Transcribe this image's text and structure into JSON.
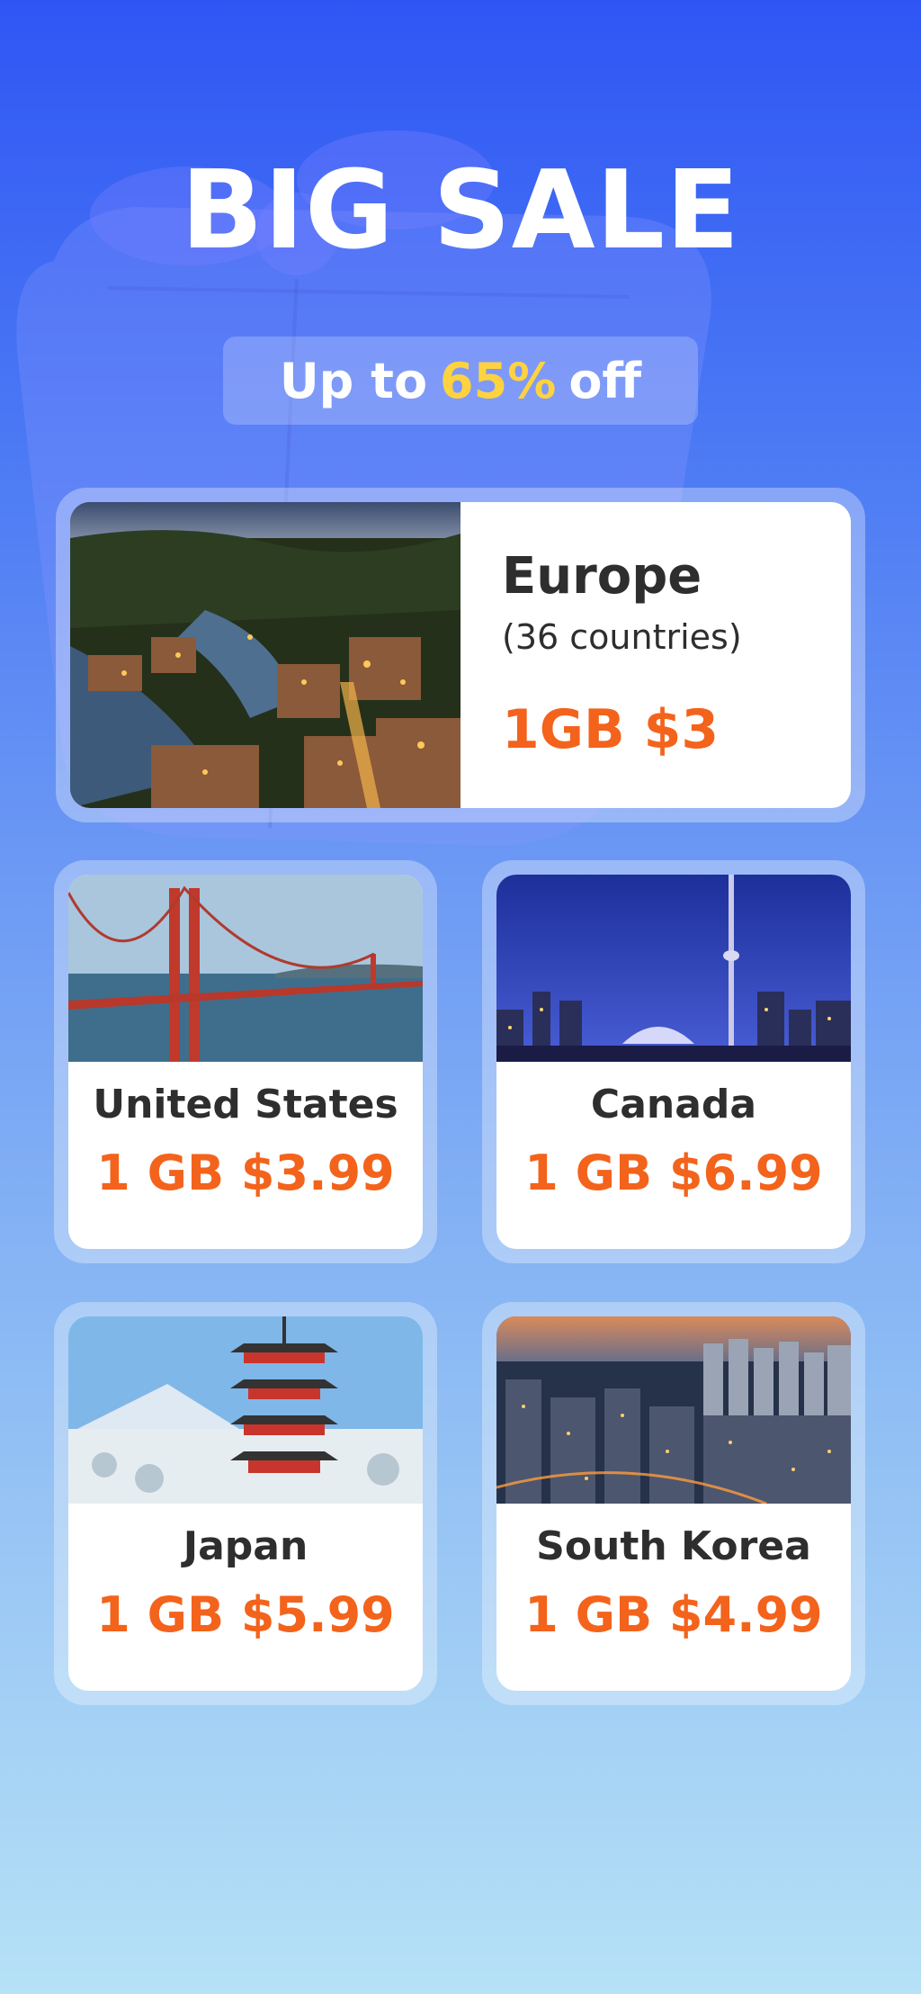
{
  "header": {
    "title": "BIG SALE",
    "promo_prefix": "Up to",
    "promo_percent": "65%",
    "promo_suffix": "off"
  },
  "featured": {
    "name": "Europe",
    "subtitle": "(36 countries)",
    "price": "1GB $3",
    "image": "town-at-night-image"
  },
  "destinations": [
    {
      "name": "United States",
      "price": "1 GB $3.99",
      "image": "golden-gate-bridge-image"
    },
    {
      "name": "Canada",
      "price": "1 GB $6.99",
      "image": "toronto-skyline-image"
    },
    {
      "name": "Japan",
      "price": "1 GB $5.99",
      "image": "pagoda-fuji-image"
    },
    {
      "name": "South Korea",
      "price": "1 GB $4.99",
      "image": "seoul-cityscape-image"
    }
  ],
  "colors": {
    "price": "#f3631c",
    "accent": "#ffd23f",
    "text": "#2e2e2e",
    "background_top": "#2f56f4",
    "background_bottom": "#b6e1f6"
  }
}
